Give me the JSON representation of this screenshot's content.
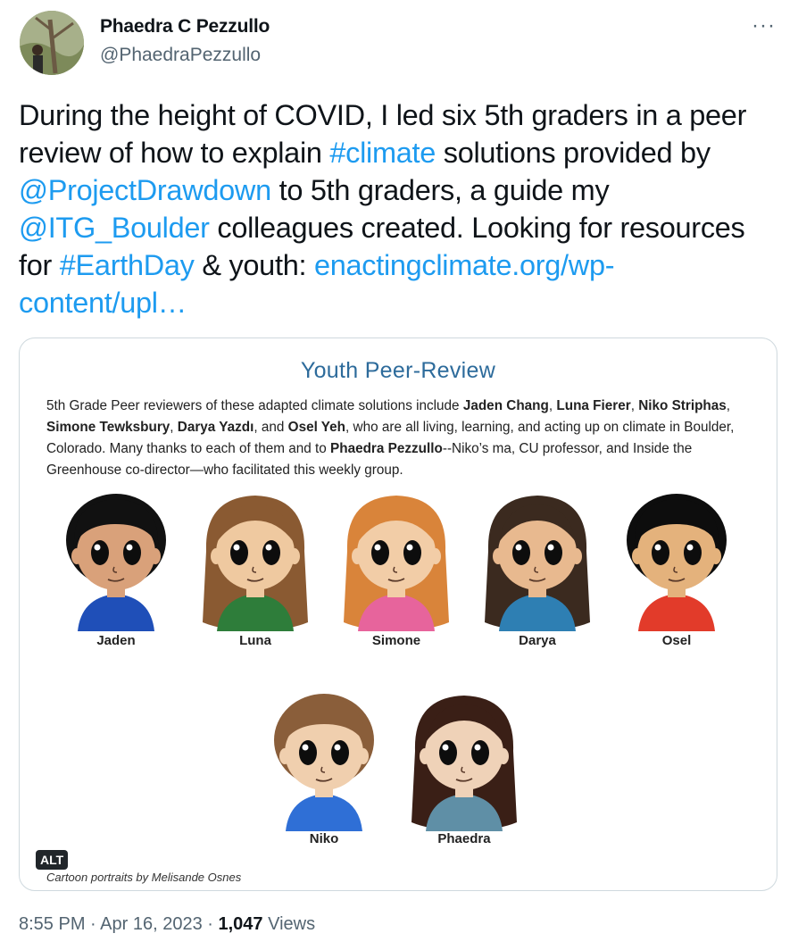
{
  "author": {
    "name": "Phaedra C Pezzullo",
    "handle": "@PhaedraPezzullo"
  },
  "more_icon": "···",
  "tweet": {
    "t1": "During the height of COVID, I led six 5th graders in a peer review of how to explain ",
    "hashtag_climate": "#climate",
    "t2": " solutions provided by ",
    "mention_drawdown": "@ProjectDrawdown",
    "t3": " to 5th graders, a guide my ",
    "mention_itg": "@ITG_Boulder",
    "t4": " colleagues created. Looking for resources for ",
    "hashtag_earthday": "#EarthDay",
    "t5": " & youth: ",
    "link": "enactingclimate.org/wp-content/upl…"
  },
  "media": {
    "title": "Youth Peer-Review",
    "body_a": "5th Grade Peer reviewers of these adapted climate solutions include ",
    "n_jaden": "Jaden Chang",
    "sep1": ", ",
    "n_luna": "Luna Fierer",
    "sep2": ", ",
    "n_niko": "Niko Striphas",
    "sep3": ", ",
    "n_simone": "Simone Tewksbury",
    "sep4": ", ",
    "n_darya": "Darya Yazdı",
    "sep5": ", and ",
    "n_osel": "Osel Yeh",
    "body_b": ", who are all living, learning, and acting up on climate in Boulder, Colorado. Many thanks to each of them and to ",
    "n_phaedra": "Phaedra Pezzullo",
    "body_c": "--Niko’s ma, CU professor, and Inside the Greenhouse co-director—who facilitated this weekly group.",
    "portraits": [
      {
        "name": "Jaden",
        "hair": "#111111",
        "shirt": "#1f4fb8",
        "skin": "#d9a17a"
      },
      {
        "name": "Luna",
        "hair": "#8a5a32",
        "shirt": "#2e7d3a",
        "skin": "#efc9a0"
      },
      {
        "name": "Simone",
        "hair": "#d9843a",
        "shirt": "#e7649c",
        "skin": "#f2cda7"
      },
      {
        "name": "Darya",
        "hair": "#3b2a1f",
        "shirt": "#2e7fb3",
        "skin": "#e8b98f"
      },
      {
        "name": "Osel",
        "hair": "#0d0d0d",
        "shirt": "#e23b2a",
        "skin": "#e4b27c"
      },
      {
        "name": "Niko",
        "hair": "#8a5e3a",
        "shirt": "#2f6fd6",
        "skin": "#f0cfae"
      },
      {
        "name": "Phaedra",
        "hair": "#3a1f16",
        "shirt": "#5f8fa6",
        "skin": "#efd2b8"
      }
    ],
    "credit": "Cartoon portraits by Melisande Osnes",
    "alt_label": "ALT"
  },
  "footer": {
    "time": "8:55 PM",
    "dot1": " · ",
    "date": "Apr 16, 2023",
    "dot2": " · ",
    "views_count": "1,047",
    "views_label": " Views"
  },
  "colors": {
    "link": "#1d9bf0",
    "muted": "#536471",
    "title_blue": "#2d6b9b"
  }
}
